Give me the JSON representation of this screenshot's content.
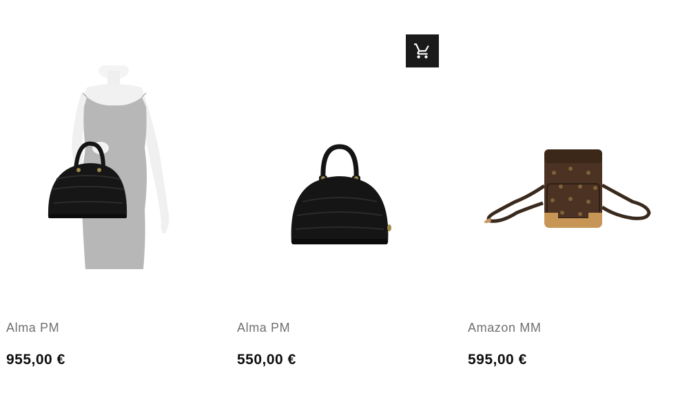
{
  "products": [
    {
      "name": "Alma PM",
      "price": "955,00 €",
      "image_icon": "mannequin-with-black-handbag"
    },
    {
      "name": "Alma PM",
      "price": "550,00 €",
      "image_icon": "black-dome-handbag"
    },
    {
      "name": "Amazon MM",
      "price": "595,00 €",
      "image_icon": "monogram-crossbody-bag"
    }
  ],
  "cart_button": {
    "icon": "shopping-cart-icon",
    "background": "#1a1a1a",
    "icon_color": "#ffffff"
  },
  "colors": {
    "name_text": "#6f6f6f",
    "price_text": "#0d0d0d",
    "background": "#ffffff"
  }
}
